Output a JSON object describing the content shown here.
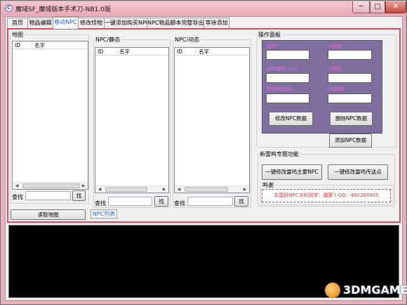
{
  "window": {
    "title": "魔域SF_魔域版本手术刀-NB1.0版",
    "icon": "app-icon",
    "minimize": "─",
    "maximize": "□",
    "close": "✕"
  },
  "tabs": [
    {
      "label": "首页"
    },
    {
      "label": "物品编辑"
    },
    {
      "label": "移动NPC",
      "active": true
    },
    {
      "label": "修改怪物"
    },
    {
      "label": "一键添加购买NPC"
    },
    {
      "label": "NPC物品脚本完整导出"
    },
    {
      "label": "等待添加"
    }
  ],
  "map_group": {
    "title": "地图",
    "columns": [
      "ID",
      "名字"
    ],
    "find_label": "查找",
    "find_button": "找",
    "read_button": "读取地图"
  },
  "npc_static": {
    "title": "NPC/静态",
    "columns": [
      "ID",
      "名字"
    ],
    "find_label": "查找",
    "find_button": "找"
  },
  "npc_dynamic": {
    "title": "NPC/动态",
    "columns": [
      "ID",
      "名字"
    ],
    "find_label": "查找",
    "find_button": "找"
  },
  "operation_panel": {
    "title": "操作面板",
    "fields": [
      {
        "label": "名字:"
      },
      {
        "label": "X坐标:"
      },
      {
        "label": "NPC脚本入口:"
      },
      {
        "label": "Y坐标:"
      },
      {
        "label": "所在地图ID:"
      },
      {
        "label": "外观ID:"
      }
    ],
    "modify_button": "修改NPC数据",
    "delete_button": "删除NPC数据",
    "add_button": "添加NPC数据"
  },
  "thunder_group": {
    "title": "新雷鸣专题功能",
    "modify_main_button": "一键修改雷鸣主要NPC",
    "modify_teleport_button": "一键修改雷鸣传送点",
    "thanks_title": "鸣谢",
    "thanks_text": "本国拆NPC点的同学：魔萝卜QQ：460268905"
  },
  "bottom_tab": {
    "label": "NPC列表"
  },
  "watermark": {
    "text": "3DMGAME"
  },
  "colors": {
    "accent": "#2a5fd6",
    "frame": "#e9b0bc",
    "highlight_border": "#e04a5a",
    "panel_purple": "#7f6f9f",
    "label_magenta": "#f06ad8",
    "thanks_red": "#e53935",
    "console_bg": "#000000"
  }
}
